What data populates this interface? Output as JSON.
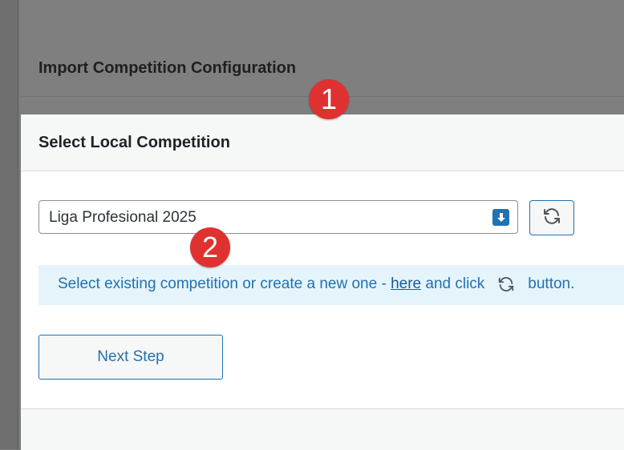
{
  "background": {
    "title": "Import Competition Configuration"
  },
  "modal": {
    "title": "Select Local Competition",
    "select": {
      "value": "Liga Profesional 2025",
      "arrow_icon": "chevron-down-icon"
    },
    "refresh_icon": "refresh-icon",
    "notice": {
      "text_before": "Select existing competition or create a new one -",
      "link_text": "here",
      "text_middle": "and click",
      "text_after": "button."
    },
    "next_button_label": "Next Step"
  },
  "badges": [
    "1",
    "2"
  ],
  "colors": {
    "accent": "#2271b1",
    "badge": "#e03131",
    "notice_bg": "#e5f4fb"
  }
}
